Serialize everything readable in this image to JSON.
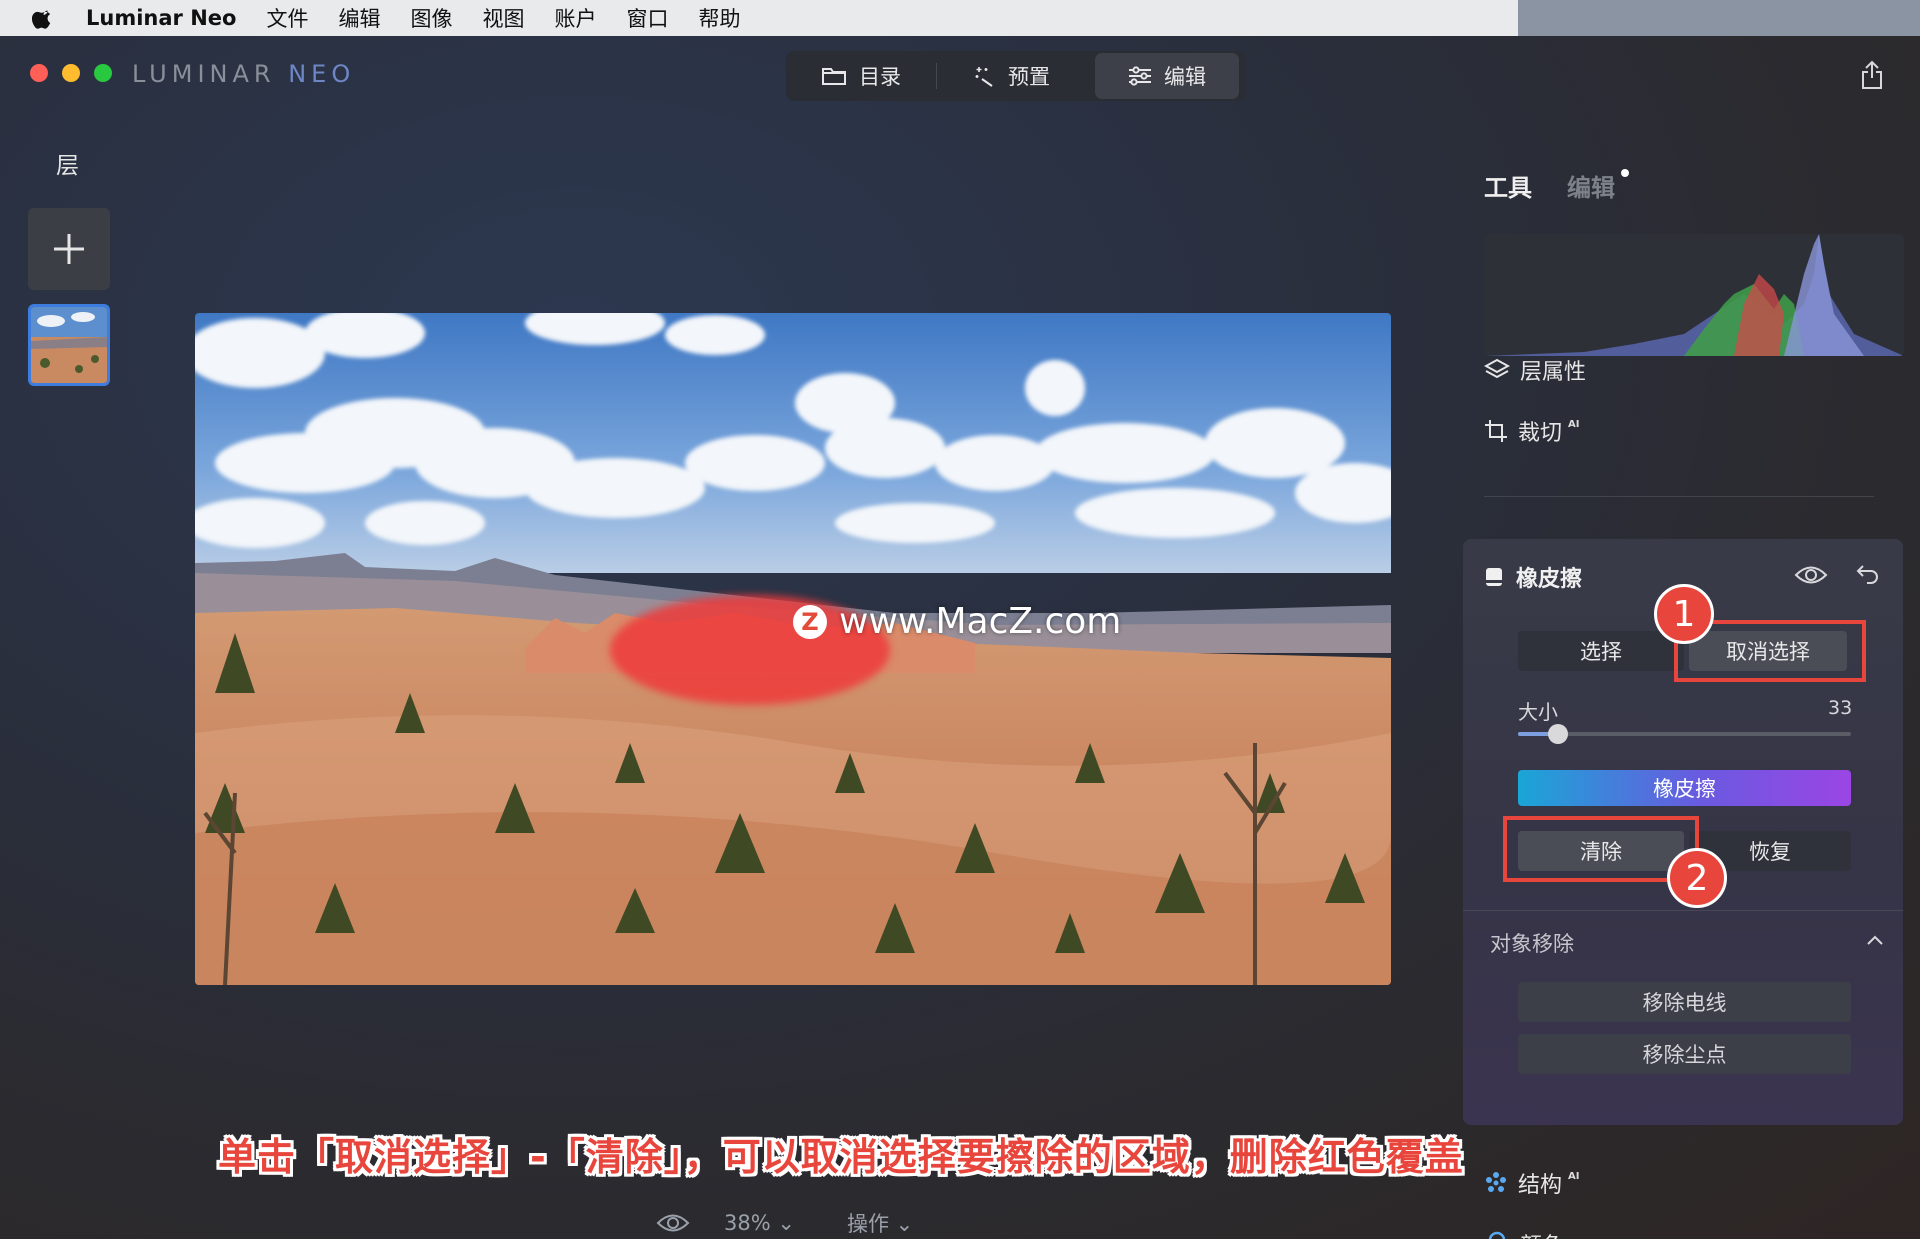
{
  "menubar": {
    "app_name": "Luminar Neo",
    "items": [
      "文件",
      "编辑",
      "图像",
      "视图",
      "账户",
      "窗口",
      "帮助"
    ]
  },
  "window": {
    "brand_left": "LUMINAR",
    "brand_right": "NEO"
  },
  "top_tabs": [
    {
      "label": "目录",
      "icon": "folder-icon"
    },
    {
      "label": "预置",
      "icon": "magic-wand-icon"
    },
    {
      "label": "编辑",
      "icon": "sliders-icon",
      "active": true
    }
  ],
  "layers": {
    "title": "层"
  },
  "canvas": {
    "watermark": "www.MacZ.com",
    "watermark_logo": "Z"
  },
  "bottom_bar": {
    "zoom": "38%",
    "actions": "操作"
  },
  "caption": "单击「取消选择」-「清除」，可以取消选择要擦除的区域，删除红色覆盖",
  "right_panel": {
    "tabs": {
      "tools": "工具",
      "edits": "编辑"
    },
    "layer_properties": "层属性",
    "crop": "裁切",
    "crop_badge": "AI",
    "eraser": {
      "title": "橡皮擦",
      "select": "选择",
      "deselect": "取消选择",
      "size_label": "大小",
      "size_value": "33",
      "size_fraction": 0.12,
      "erase_button": "橡皮擦",
      "clear": "清除",
      "restore": "恢复"
    },
    "object_removal": {
      "title": "对象移除",
      "remove_powerlines": "移除电线",
      "remove_dust": "移除尘点"
    },
    "structure": "结构",
    "structure_badge": "AI",
    "color": "颜色"
  },
  "annotations": {
    "marker1": "1",
    "marker2": "2",
    "highlight_color": "#e8463c"
  },
  "colors": {
    "accent_blue": "#3d7de0",
    "erase_gradient_start": "#1aa6d6",
    "erase_gradient_end": "#9b45e4"
  }
}
